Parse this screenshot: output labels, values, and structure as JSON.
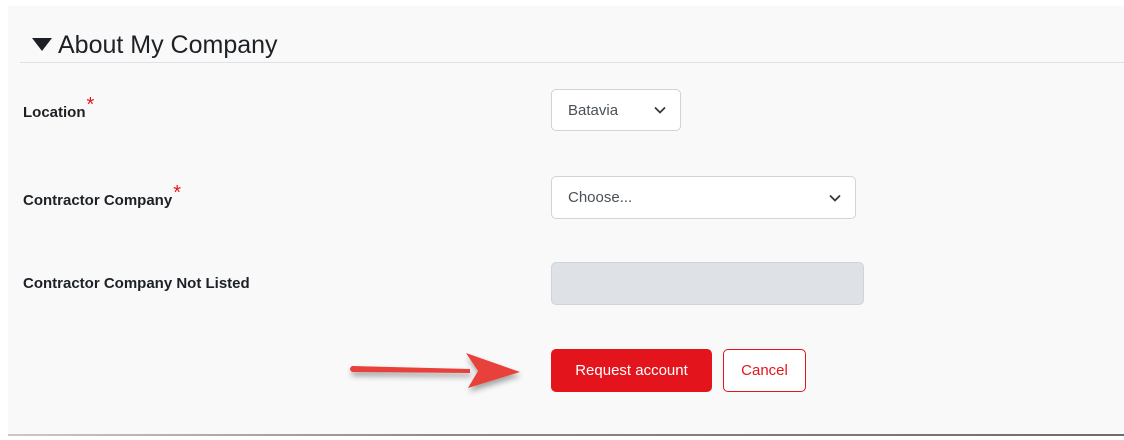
{
  "section": {
    "title": "About My Company"
  },
  "form": {
    "location": {
      "label": "Location",
      "required_mark": "*",
      "selected": "Batavia"
    },
    "contractor_company": {
      "label": "Contractor Company",
      "required_mark": "*",
      "selected": "Choose..."
    },
    "contractor_not_listed": {
      "label": "Contractor Company Not Listed",
      "value": ""
    }
  },
  "actions": {
    "request_label": "Request account",
    "cancel_label": "Cancel"
  },
  "colors": {
    "accent": "#e4141d",
    "disabled_input": "#dee2e6",
    "annotation_arrow": "#e8403a"
  }
}
